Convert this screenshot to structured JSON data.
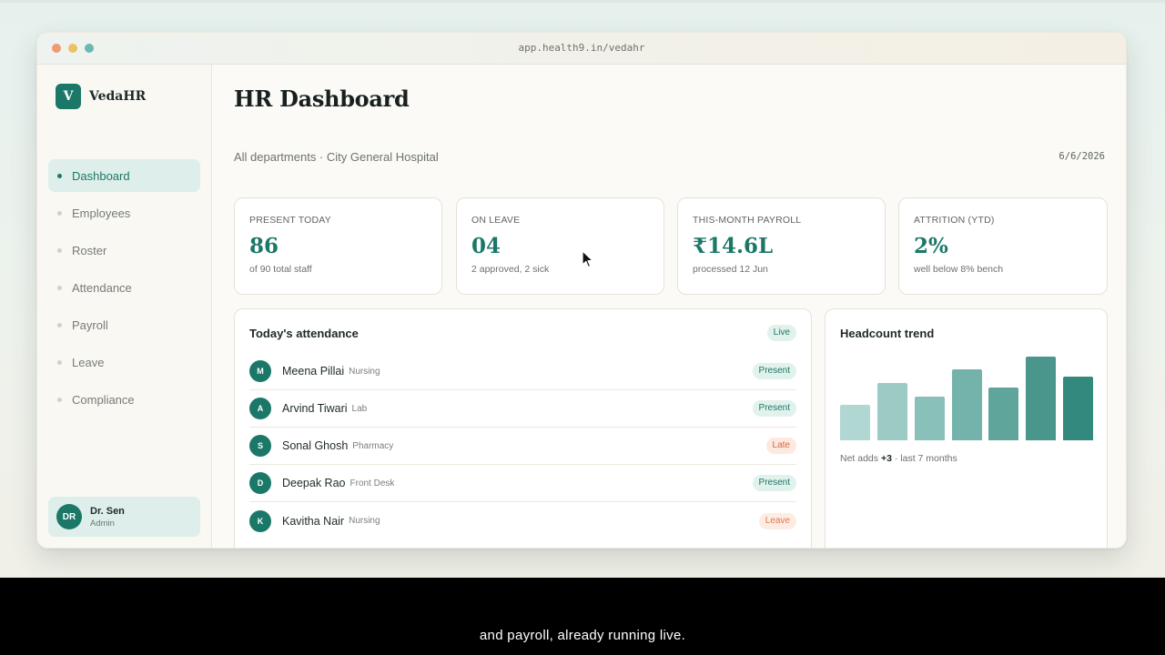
{
  "browser": {
    "url": "app.health9.in/vedahr"
  },
  "brand": {
    "logo_letter": "V",
    "name": "VedaHR"
  },
  "sidebar": {
    "items": [
      {
        "label": "Dashboard",
        "active": true
      },
      {
        "label": "Employees"
      },
      {
        "label": "Roster"
      },
      {
        "label": "Attendance"
      },
      {
        "label": "Payroll"
      },
      {
        "label": "Leave"
      },
      {
        "label": "Compliance"
      }
    ]
  },
  "user": {
    "initials": "DR",
    "name": "Dr. Sen",
    "role": "Admin"
  },
  "header": {
    "title": "HR Dashboard",
    "subtitle": "All departments · City General Hospital",
    "date": "6/6/2026"
  },
  "stats": [
    {
      "label": "PRESENT TODAY",
      "value": "86",
      "note": "of 90 total staff"
    },
    {
      "label": "ON LEAVE",
      "value": "04",
      "note": "2 approved, 2 sick"
    },
    {
      "label": "THIS-MONTH PAYROLL",
      "value": "₹14.6L",
      "note": "processed 12 Jun"
    },
    {
      "label": "ATTRITION (YTD)",
      "value": "2%",
      "note": "well below 8% bench"
    }
  ],
  "attendance": {
    "title": "Today's attendance",
    "badge": "Live",
    "rows": [
      {
        "initial": "M",
        "name": "Meena Pillai",
        "dept": "Nursing",
        "status": "Present"
      },
      {
        "initial": "A",
        "name": "Arvind Tiwari",
        "dept": "Lab",
        "status": "Present"
      },
      {
        "initial": "S",
        "name": "Sonal Ghosh",
        "dept": "Pharmacy",
        "status": "Late"
      },
      {
        "initial": "D",
        "name": "Deepak Rao",
        "dept": "Front Desk",
        "status": "Present"
      },
      {
        "initial": "K",
        "name": "Kavitha Nair",
        "dept": "Nursing",
        "status": "Leave"
      }
    ]
  },
  "headcount": {
    "title": "Headcount trend",
    "note_prefix": "Net adds",
    "note_value": "+3",
    "note_suffix": "· last 7 months"
  },
  "chart_data": {
    "type": "bar",
    "title": "Headcount trend",
    "categories": [
      "",
      "",
      "",
      "",
      "",
      "",
      ""
    ],
    "values": [
      38,
      62,
      47,
      76,
      57,
      90,
      68
    ],
    "colors": [
      "#b0d7d2",
      "#9ccbc5",
      "#89c0b9",
      "#74b3ab",
      "#5fa59c",
      "#4a968c",
      "#34897e"
    ]
  },
  "caption": {
    "text": "and payroll, already running live."
  },
  "icons": {
    "cursor": "arrow-cursor-icon"
  }
}
